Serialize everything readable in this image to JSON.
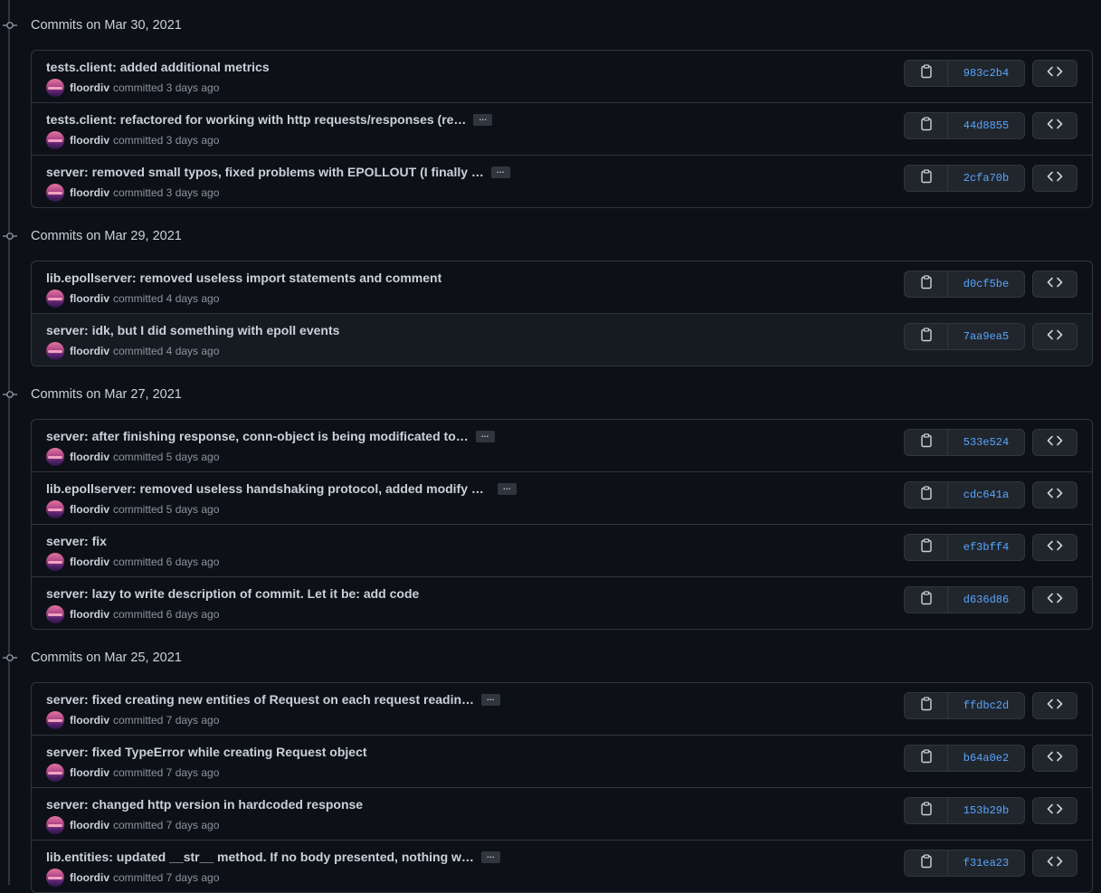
{
  "groups": [
    {
      "date_label": "Commits on Mar 30, 2021",
      "commits": [
        {
          "message": "tests.client: added additional metrics",
          "truncated": false,
          "author": "floordiv",
          "time": "committed 3 days ago",
          "sha": "983c2b4"
        },
        {
          "message": "tests.client: refactored for working with http requests/responses (re…",
          "truncated": true,
          "author": "floordiv",
          "time": "committed 3 days ago",
          "sha": "44d8855"
        },
        {
          "message": "server: removed small typos, fixed problems with EPOLLOUT (I finally …",
          "truncated": true,
          "author": "floordiv",
          "time": "committed 3 days ago",
          "sha": "2cfa70b"
        }
      ]
    },
    {
      "date_label": "Commits on Mar 29, 2021",
      "commits": [
        {
          "message": "lib.epollserver: removed useless import statements and comment",
          "truncated": false,
          "author": "floordiv",
          "time": "committed 4 days ago",
          "sha": "d0cf5be"
        },
        {
          "message": "server: idk, but I did something with epoll events",
          "truncated": false,
          "author": "floordiv",
          "time": "committed 4 days ago",
          "sha": "7aa9ea5",
          "highlighted": true
        }
      ]
    },
    {
      "date_label": "Commits on Mar 27, 2021",
      "commits": [
        {
          "message": "server: after finishing response, conn-object is being modificated to…",
          "truncated": true,
          "author": "floordiv",
          "time": "committed 5 days ago",
          "sha": "533e524"
        },
        {
          "message": "lib.epollserver: removed useless handshaking protocol, added modify m…",
          "truncated": true,
          "author": "floordiv",
          "time": "committed 5 days ago",
          "sha": "cdc641a"
        },
        {
          "message": "server: fix",
          "truncated": false,
          "author": "floordiv",
          "time": "committed 6 days ago",
          "sha": "ef3bff4"
        },
        {
          "message": "server: lazy to write description of commit. Let it be: add code",
          "truncated": false,
          "author": "floordiv",
          "time": "committed 6 days ago",
          "sha": "d636d86"
        }
      ]
    },
    {
      "date_label": "Commits on Mar 25, 2021",
      "commits": [
        {
          "message": "server: fixed creating new entities of Request on each request readin…",
          "truncated": true,
          "author": "floordiv",
          "time": "committed 7 days ago",
          "sha": "ffdbc2d"
        },
        {
          "message": "server: fixed TypeError while creating Request object",
          "truncated": false,
          "author": "floordiv",
          "time": "committed 7 days ago",
          "sha": "b64a0e2"
        },
        {
          "message": "server: changed http version in hardcoded response",
          "truncated": false,
          "author": "floordiv",
          "time": "committed 7 days ago",
          "sha": "153b29b"
        },
        {
          "message": "lib.entities: updated __str__ method. If no body presented, nothing w…",
          "truncated": true,
          "author": "floordiv",
          "time": "committed 7 days ago",
          "sha": "f31ea23"
        }
      ]
    }
  ],
  "ellipsis_label": "…",
  "icons": {
    "copy": "clipboard-icon",
    "browse": "code-icon",
    "node": "git-commit-icon"
  },
  "colors": {
    "background": "#0d1117",
    "border": "#30363d",
    "sha_link": "#58a6ff",
    "muted": "#8b949e",
    "text": "#c9d1d9"
  }
}
